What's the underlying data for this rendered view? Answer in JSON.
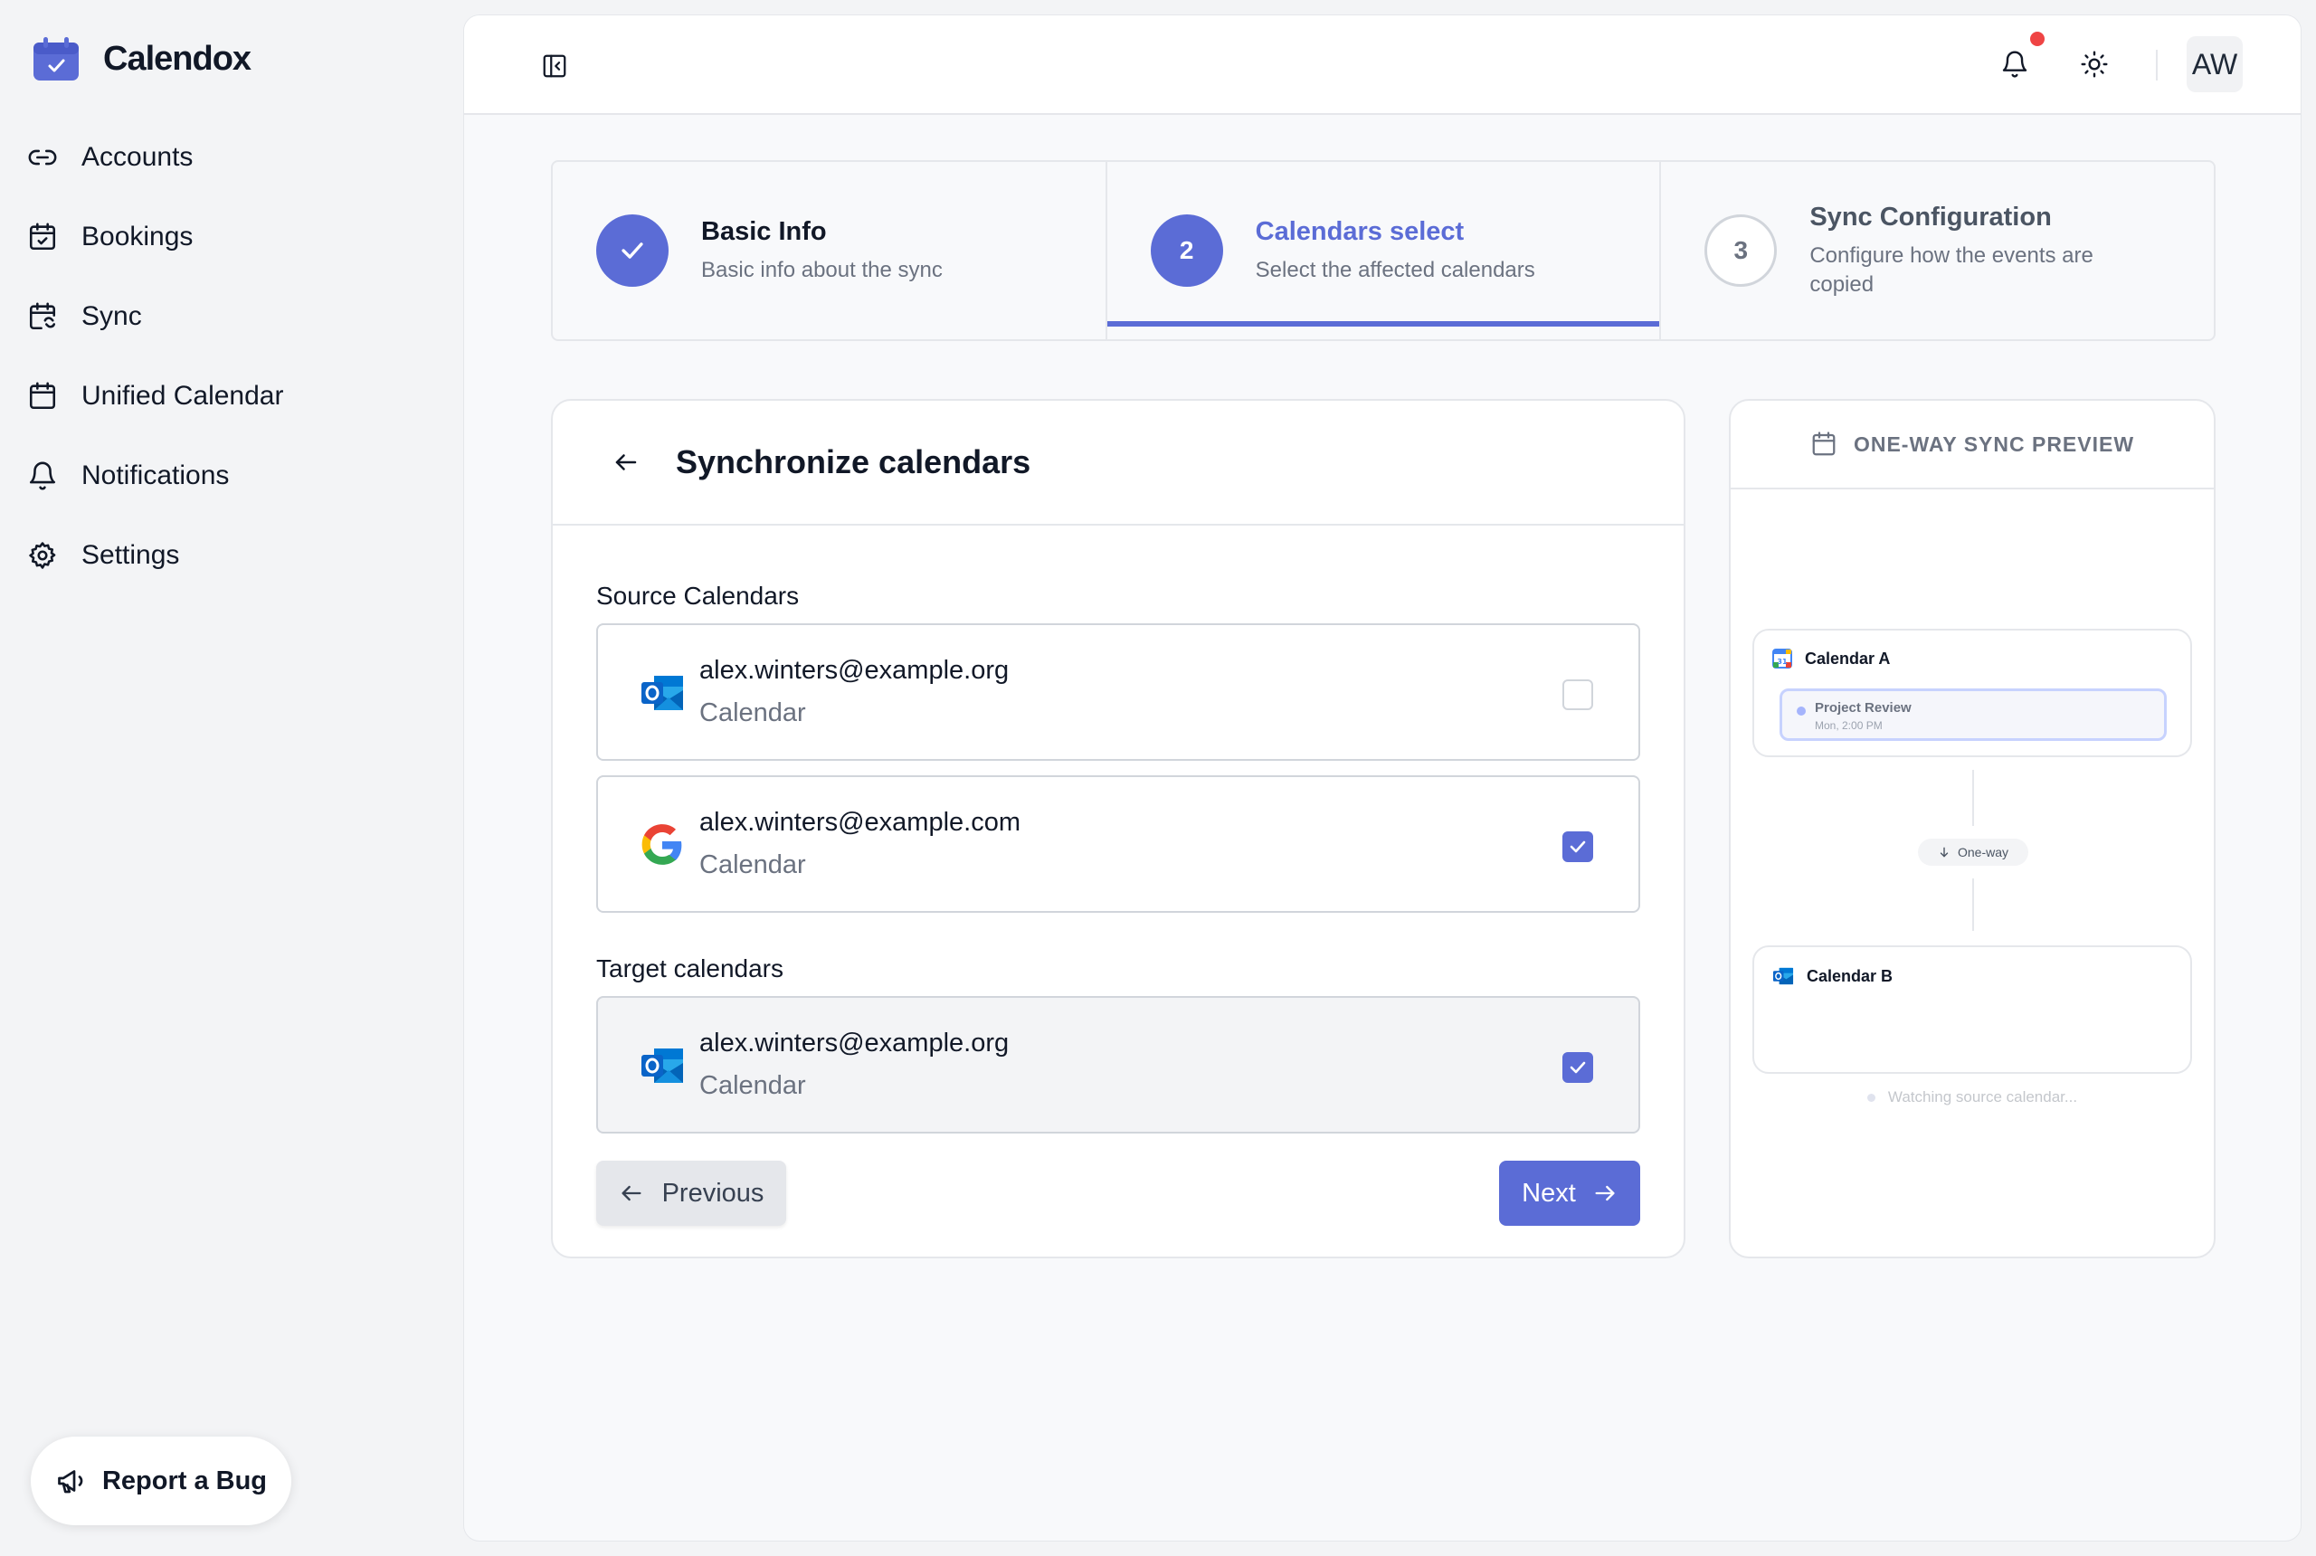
{
  "brand": {
    "name": "Calendox"
  },
  "sidebar": {
    "items": [
      {
        "label": "Accounts",
        "icon": "link-icon"
      },
      {
        "label": "Bookings",
        "icon": "calendar-check-icon"
      },
      {
        "label": "Sync",
        "icon": "calendar-sync-icon"
      },
      {
        "label": "Unified Calendar",
        "icon": "calendar-icon"
      },
      {
        "label": "Notifications",
        "icon": "bell-icon"
      },
      {
        "label": "Settings",
        "icon": "gear-icon"
      }
    ],
    "report_bug": "Report a Bug"
  },
  "topbar": {
    "avatar_initials": "AW",
    "has_notification": true
  },
  "stepper": {
    "steps": [
      {
        "title": "Basic Info",
        "subtitle": "Basic info about the sync",
        "state": "done"
      },
      {
        "number": "2",
        "title": "Calendars select",
        "subtitle": "Select the affected calendars",
        "state": "current"
      },
      {
        "number": "3",
        "title": "Sync Configuration",
        "subtitle": "Configure how the events are copied",
        "state": "todo"
      }
    ]
  },
  "form": {
    "title": "Synchronize calendars",
    "source_label": "Source Calendars",
    "target_label": "Target calendars",
    "source_calendars": [
      {
        "email": "alex.winters@example.org",
        "kind": "Calendar",
        "provider": "outlook",
        "checked": false
      },
      {
        "email": "alex.winters@example.com",
        "kind": "Calendar",
        "provider": "google",
        "checked": true
      }
    ],
    "target_calendars": [
      {
        "email": "alex.winters@example.org",
        "kind": "Calendar",
        "provider": "outlook",
        "checked": true
      }
    ],
    "previous_label": "Previous",
    "next_label": "Next"
  },
  "preview": {
    "title": "ONE-WAY SYNC PREVIEW",
    "calendar_a": "Calendar A",
    "event_title": "Project Review",
    "event_time": "Mon, 2:00 PM",
    "direction": "One-way",
    "calendar_b": "Calendar B",
    "status": "Watching source calendar..."
  },
  "colors": {
    "accent": "#5b6cd6",
    "notification": "#ef4444",
    "outlook": "#0a64c8"
  }
}
